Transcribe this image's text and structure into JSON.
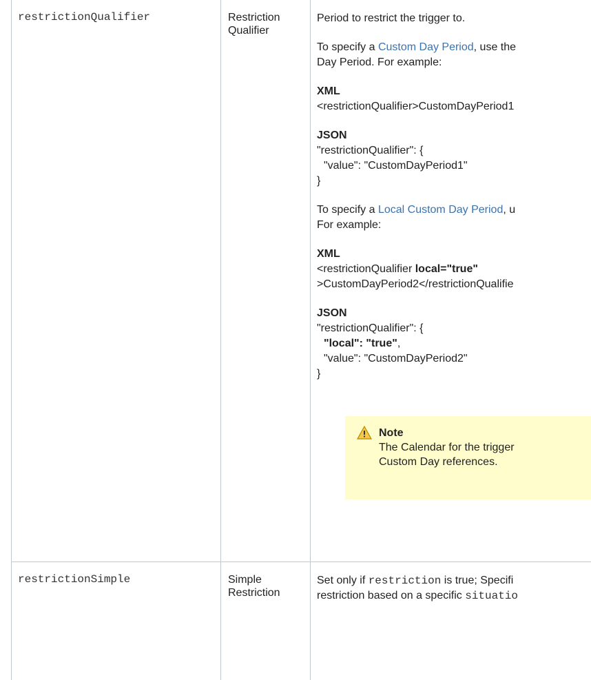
{
  "rows": [
    {
      "name": "restrictionQualifier",
      "label": "Restriction Qualifier",
      "desc": {
        "intro": "Period to restrict the trigger to.",
        "p1_prefix": "To specify a ",
        "p1_link": "Custom Day Period",
        "p1_suffix": ", use the",
        "p1_line2": "Day Period. For example:",
        "xml_label": "XML",
        "xml_line": "<restrictionQualifier>CustomDayPeriod1",
        "json_label": "JSON",
        "json_lines": [
          "\"restrictionQualifier\": {",
          "\"value\": \"CustomDayPeriod1\"",
          "}"
        ],
        "p2_prefix": "To specify a ",
        "p2_link": "Local Custom Day Period",
        "p2_suffix": ", u",
        "p2_line2": "For example:",
        "xml2_label": "XML",
        "xml2_line1_prefix": "<restrictionQualifier ",
        "xml2_line1_bold": "local=\"true\"",
        "xml2_line2": ">CustomDayPeriod2</restrictionQualifie",
        "json2_label": "JSON",
        "json2_line1": "\"restrictionQualifier\": {",
        "json2_line2_bold": "\"local\": \"true\"",
        "json2_line2_suffix": ",",
        "json2_line3": "\"value\": \"CustomDayPeriod2\"",
        "json2_line4": "}",
        "note_title": "Note",
        "note_line1": "The Calendar for the trigger",
        "note_line2": "Custom Day references."
      }
    },
    {
      "name": "restrictionSimple",
      "label": "Simple Restriction",
      "desc": {
        "l1_prefix": "Set only if ",
        "l1_code": "restriction",
        "l1_suffix": " is true; Specifi",
        "l2_prefix": "restriction based on a specific ",
        "l2_code": "situatio"
      }
    }
  ],
  "icons": {
    "note": "warning-icon"
  },
  "colors": {
    "link": "#3b73af",
    "note_bg": "#fffdcb",
    "border": "#c1c7d0"
  }
}
